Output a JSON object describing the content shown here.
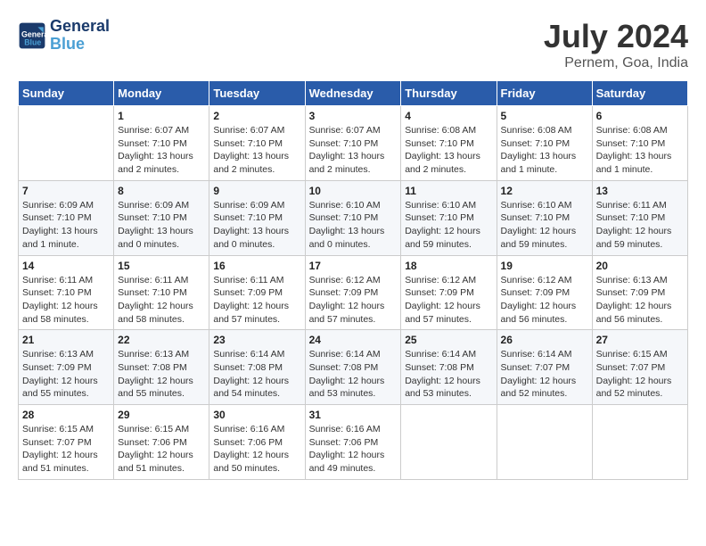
{
  "header": {
    "logo_line1": "General",
    "logo_line2": "Blue",
    "month_year": "July 2024",
    "location": "Pernem, Goa, India"
  },
  "weekdays": [
    "Sunday",
    "Monday",
    "Tuesday",
    "Wednesday",
    "Thursday",
    "Friday",
    "Saturday"
  ],
  "weeks": [
    [
      {
        "day": "",
        "info": ""
      },
      {
        "day": "1",
        "info": "Sunrise: 6:07 AM\nSunset: 7:10 PM\nDaylight: 13 hours and 2 minutes."
      },
      {
        "day": "2",
        "info": "Sunrise: 6:07 AM\nSunset: 7:10 PM\nDaylight: 13 hours and 2 minutes."
      },
      {
        "day": "3",
        "info": "Sunrise: 6:07 AM\nSunset: 7:10 PM\nDaylight: 13 hours and 2 minutes."
      },
      {
        "day": "4",
        "info": "Sunrise: 6:08 AM\nSunset: 7:10 PM\nDaylight: 13 hours and 2 minutes."
      },
      {
        "day": "5",
        "info": "Sunrise: 6:08 AM\nSunset: 7:10 PM\nDaylight: 13 hours and 1 minute."
      },
      {
        "day": "6",
        "info": "Sunrise: 6:08 AM\nSunset: 7:10 PM\nDaylight: 13 hours and 1 minute."
      }
    ],
    [
      {
        "day": "7",
        "info": "Sunrise: 6:09 AM\nSunset: 7:10 PM\nDaylight: 13 hours and 1 minute."
      },
      {
        "day": "8",
        "info": "Sunrise: 6:09 AM\nSunset: 7:10 PM\nDaylight: 13 hours and 0 minutes."
      },
      {
        "day": "9",
        "info": "Sunrise: 6:09 AM\nSunset: 7:10 PM\nDaylight: 13 hours and 0 minutes."
      },
      {
        "day": "10",
        "info": "Sunrise: 6:10 AM\nSunset: 7:10 PM\nDaylight: 13 hours and 0 minutes."
      },
      {
        "day": "11",
        "info": "Sunrise: 6:10 AM\nSunset: 7:10 PM\nDaylight: 12 hours and 59 minutes."
      },
      {
        "day": "12",
        "info": "Sunrise: 6:10 AM\nSunset: 7:10 PM\nDaylight: 12 hours and 59 minutes."
      },
      {
        "day": "13",
        "info": "Sunrise: 6:11 AM\nSunset: 7:10 PM\nDaylight: 12 hours and 59 minutes."
      }
    ],
    [
      {
        "day": "14",
        "info": "Sunrise: 6:11 AM\nSunset: 7:10 PM\nDaylight: 12 hours and 58 minutes."
      },
      {
        "day": "15",
        "info": "Sunrise: 6:11 AM\nSunset: 7:10 PM\nDaylight: 12 hours and 58 minutes."
      },
      {
        "day": "16",
        "info": "Sunrise: 6:11 AM\nSunset: 7:09 PM\nDaylight: 12 hours and 57 minutes."
      },
      {
        "day": "17",
        "info": "Sunrise: 6:12 AM\nSunset: 7:09 PM\nDaylight: 12 hours and 57 minutes."
      },
      {
        "day": "18",
        "info": "Sunrise: 6:12 AM\nSunset: 7:09 PM\nDaylight: 12 hours and 57 minutes."
      },
      {
        "day": "19",
        "info": "Sunrise: 6:12 AM\nSunset: 7:09 PM\nDaylight: 12 hours and 56 minutes."
      },
      {
        "day": "20",
        "info": "Sunrise: 6:13 AM\nSunset: 7:09 PM\nDaylight: 12 hours and 56 minutes."
      }
    ],
    [
      {
        "day": "21",
        "info": "Sunrise: 6:13 AM\nSunset: 7:09 PM\nDaylight: 12 hours and 55 minutes."
      },
      {
        "day": "22",
        "info": "Sunrise: 6:13 AM\nSunset: 7:08 PM\nDaylight: 12 hours and 55 minutes."
      },
      {
        "day": "23",
        "info": "Sunrise: 6:14 AM\nSunset: 7:08 PM\nDaylight: 12 hours and 54 minutes."
      },
      {
        "day": "24",
        "info": "Sunrise: 6:14 AM\nSunset: 7:08 PM\nDaylight: 12 hours and 53 minutes."
      },
      {
        "day": "25",
        "info": "Sunrise: 6:14 AM\nSunset: 7:08 PM\nDaylight: 12 hours and 53 minutes."
      },
      {
        "day": "26",
        "info": "Sunrise: 6:14 AM\nSunset: 7:07 PM\nDaylight: 12 hours and 52 minutes."
      },
      {
        "day": "27",
        "info": "Sunrise: 6:15 AM\nSunset: 7:07 PM\nDaylight: 12 hours and 52 minutes."
      }
    ],
    [
      {
        "day": "28",
        "info": "Sunrise: 6:15 AM\nSunset: 7:07 PM\nDaylight: 12 hours and 51 minutes."
      },
      {
        "day": "29",
        "info": "Sunrise: 6:15 AM\nSunset: 7:06 PM\nDaylight: 12 hours and 51 minutes."
      },
      {
        "day": "30",
        "info": "Sunrise: 6:16 AM\nSunset: 7:06 PM\nDaylight: 12 hours and 50 minutes."
      },
      {
        "day": "31",
        "info": "Sunrise: 6:16 AM\nSunset: 7:06 PM\nDaylight: 12 hours and 49 minutes."
      },
      {
        "day": "",
        "info": ""
      },
      {
        "day": "",
        "info": ""
      },
      {
        "day": "",
        "info": ""
      }
    ]
  ]
}
